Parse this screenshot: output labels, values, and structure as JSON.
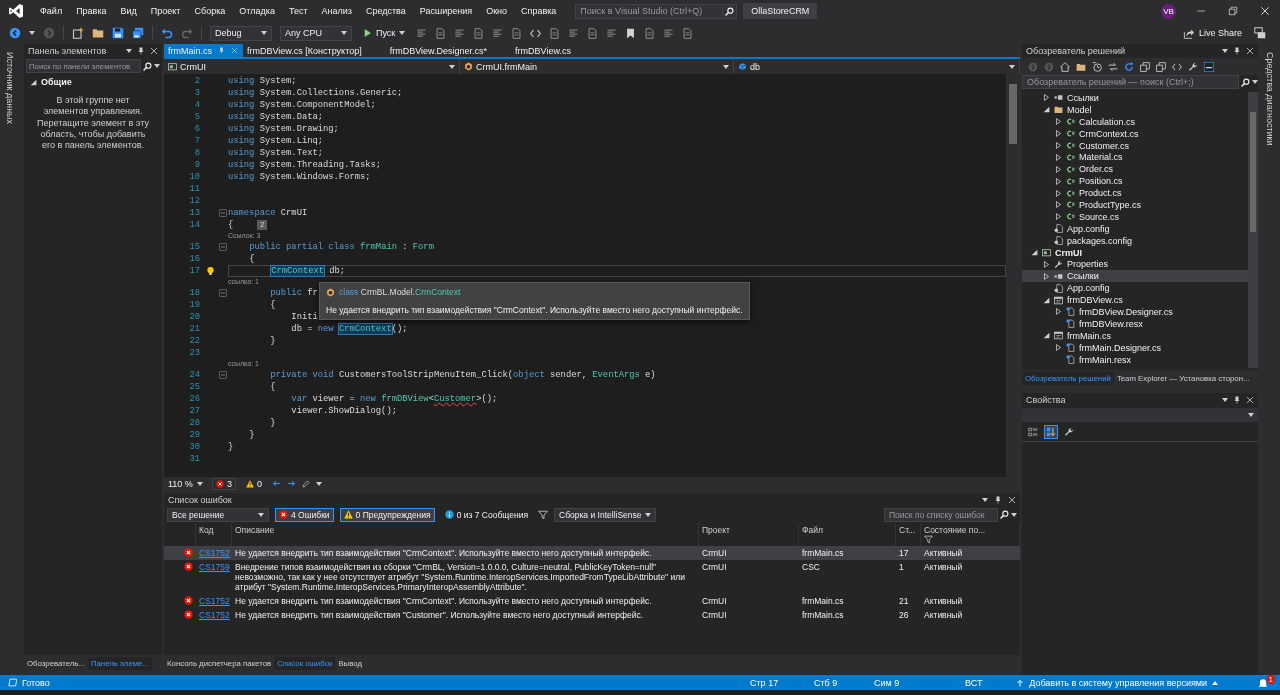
{
  "window": {
    "menu": [
      "Файл",
      "Правка",
      "Вид",
      "Проект",
      "Сборка",
      "Отладка",
      "Тест",
      "Анализ",
      "Средства",
      "Расширения",
      "Окно",
      "Справка"
    ],
    "search": {
      "placeholder": "Поиск в Visual Studio (Ctrl+Q)"
    },
    "solution_name": "OllaStoreCRM",
    "account": "VB"
  },
  "toolbar": {
    "configuration": "Debug",
    "platform": "Any CPU",
    "start": "Пуск",
    "live_share": "Live Share"
  },
  "left_strip": "Источник данных",
  "toolbox": {
    "title": "Панель элементов",
    "search": {
      "placeholder": "Поиск по панели элементов"
    },
    "group": {
      "label": "Общие",
      "expanded": true
    },
    "empty_message": "В этой группе нет элементов управления. Перетащите элемент в эту область, чтобы добавить его в панель элементов."
  },
  "left_tabs": [
    {
      "label": "Обозреватель...",
      "selected": false
    },
    {
      "label": "Панель элеме...",
      "selected": true
    }
  ],
  "document_tabs": [
    {
      "label": "frmMain.cs",
      "selected": true
    },
    {
      "label": "frmDBView.cs [Конструктор]",
      "selected": false
    },
    {
      "label": "frmDBView.Designer.cs*",
      "selected": false
    },
    {
      "label": "frmDBView.cs",
      "selected": false
    }
  ],
  "navigation": [
    {
      "kind": "project",
      "label": "CrmUI"
    },
    {
      "kind": "class",
      "label": "CrmUI.frmMain"
    },
    {
      "kind": "field",
      "label": "db"
    }
  ],
  "editor": {
    "rows": [
      {
        "n": "2",
        "code": [
          {
            "text": "using",
            "kind": "keyword"
          },
          {
            "text": " System;"
          }
        ]
      },
      {
        "n": "3",
        "code": [
          {
            "text": "using",
            "kind": "keyword"
          },
          {
            "text": " System.Collections.Generic;"
          }
        ]
      },
      {
        "n": "4",
        "code": [
          {
            "text": "using",
            "kind": "keyword"
          },
          {
            "text": " System.ComponentModel;"
          }
        ]
      },
      {
        "n": "5",
        "code": [
          {
            "text": "using",
            "kind": "keyword"
          },
          {
            "text": " System.Data;"
          }
        ]
      },
      {
        "n": "6",
        "code": [
          {
            "text": "using",
            "kind": "keyword"
          },
          {
            "text": " System.Drawing;"
          }
        ]
      },
      {
        "n": "7",
        "code": [
          {
            "text": "using",
            "kind": "keyword"
          },
          {
            "text": " System.Linq;"
          }
        ]
      },
      {
        "n": "8",
        "code": [
          {
            "text": "using",
            "kind": "keyword"
          },
          {
            "text": " System.Text;"
          }
        ]
      },
      {
        "n": "9",
        "code": [
          {
            "text": "using",
            "kind": "keyword"
          },
          {
            "text": " System.Threading.Tasks;"
          }
        ]
      },
      {
        "n": "10",
        "code": [
          {
            "text": "using",
            "kind": "keyword"
          },
          {
            "text": " System.Windows.Forms;"
          }
        ]
      },
      {
        "n": "11"
      },
      {
        "n": "12"
      },
      {
        "n": "13",
        "fold": true,
        "code": [
          {
            "text": "namespace",
            "kind": "keyword"
          },
          {
            "text": " CrmUI"
          }
        ]
      },
      {
        "n": "14",
        "code": [
          {
            "text": "{"
          }
        ],
        "hint": "2"
      },
      {
        "lens": "Ссылок: 3"
      },
      {
        "n": "15",
        "fold": true,
        "code": [
          {
            "text": "    public",
            "kind": "keyword"
          },
          {
            "text": " partial",
            "kind": "keyword"
          },
          {
            "text": " class",
            "kind": "keyword"
          },
          {
            "text": " frmMain",
            "kind": "type"
          },
          {
            "text": " : "
          },
          {
            "text": "Form",
            "kind": "type"
          }
        ]
      },
      {
        "n": "16",
        "code": [
          {
            "text": "    {"
          }
        ]
      },
      {
        "n": "17",
        "current": true,
        "lightbulb": true,
        "code": [
          {
            "text": "        CrmContext",
            "kind": "reference"
          },
          {
            "text": " db;"
          }
        ]
      },
      {
        "lens": "ссылка: 1"
      },
      {
        "n": "18",
        "fold": true,
        "code": [
          {
            "text": "        public",
            "kind": "keyword"
          },
          {
            "text": " fr"
          }
        ]
      },
      {
        "n": "19",
        "code": [
          {
            "text": "        {"
          }
        ]
      },
      {
        "n": "20",
        "code": [
          {
            "text": "            Initi"
          }
        ]
      },
      {
        "n": "21",
        "code": [
          {
            "text": "            db = "
          },
          {
            "text": "new",
            "kind": "keyword"
          },
          {
            "text": " CrmContext",
            "kind": "reference"
          },
          {
            "text": "();"
          }
        ]
      },
      {
        "n": "22",
        "code": [
          {
            "text": "        }"
          }
        ]
      },
      {
        "n": "23"
      },
      {
        "lens": "ссылка: 1"
      },
      {
        "n": "24",
        "fold": true,
        "code": [
          {
            "text": "        private",
            "kind": "keyword"
          },
          {
            "text": " void",
            "kind": "keyword"
          },
          {
            "text": " CustomersToolStripMenuItem_Click("
          },
          {
            "text": "object",
            "kind": "keyword"
          },
          {
            "text": " sender, "
          },
          {
            "text": "EventArgs",
            "kind": "type"
          },
          {
            "text": " e)"
          }
        ]
      },
      {
        "n": "25",
        "code": [
          {
            "text": "        {"
          }
        ]
      },
      {
        "n": "26",
        "code": [
          {
            "text": "            var",
            "kind": "keyword"
          },
          {
            "text": " viewer = "
          },
          {
            "text": "new",
            "kind": "keyword"
          },
          {
            "text": " frmDBView",
            "kind": "type"
          },
          {
            "text": "<"
          },
          {
            "text": "Customer",
            "kind": "error_type"
          },
          {
            "text": ">();"
          }
        ]
      },
      {
        "n": "27",
        "code": [
          {
            "text": "            viewer.ShowDialog();"
          }
        ]
      },
      {
        "n": "28",
        "code": [
          {
            "text": "        }"
          }
        ]
      },
      {
        "n": "29",
        "code": [
          {
            "text": "    }"
          }
        ]
      },
      {
        "n": "30",
        "code": [
          {
            "text": "}"
          }
        ]
      },
      {
        "n": "31"
      }
    ],
    "tooltip": {
      "signature": [
        {
          "text": "class",
          "kind": "keyword"
        },
        {
          "text": " CrmBL.Model."
        },
        {
          "text": "CrmContext",
          "kind": "type"
        }
      ],
      "message": "Не удается внедрить тип взаимодействия \"CrmContext\". Используйте вместо него доступный интерфейс."
    }
  },
  "editor_status": {
    "zoom": "110 %",
    "errors": "3",
    "warnings": "0"
  },
  "error_list": {
    "title": "Список ошибок",
    "scope": "Все решение",
    "filters": [
      {
        "kind": "error",
        "label": "4 Ошибки",
        "selected": true
      },
      {
        "kind": "warning",
        "label": "0 Предупреждения",
        "selected": true
      },
      {
        "kind": "info",
        "label": "0 из 7 Сообщения",
        "selected": false
      }
    ],
    "source": "Сборка и IntelliSense",
    "search": {
      "placeholder": "Поиск по списку ошибок"
    },
    "columns": [
      "Код",
      "Описание",
      "Проект",
      "Файл",
      "Ст...",
      "Состояние по..."
    ],
    "rows": [
      {
        "code": "CS1752",
        "description": "Не удается внедрить тип взаимодействия \"CrmContext\". Используйте вместо него доступный интерфейс.",
        "project": "CrmUI",
        "file": "frmMain.cs",
        "line": "17",
        "state": "Активный",
        "selected": true
      },
      {
        "code": "CS1759",
        "description": "Внедрение типов взаимодействия из сборки \"CrmBL, Version=1.0.0.0, Culture=neutral, PublicKeyToken=null\" невозможно, так как у нее отсутствует атрибут \"System.Runtime.InteropServices.ImportedFromTypeLibAttribute\" или атрибут \"System.Runtime.InteropServices.PrimaryInteropAssemblyAttribute\".",
        "project": "CrmUI",
        "file": "CSC",
        "line": "1",
        "state": "Активный",
        "selected": false
      },
      {
        "code": "CS1752",
        "description": "Не удается внедрить тип взаимодействия \"CrmContext\". Используйте вместо него доступный интерфейс.",
        "project": "CrmUI",
        "file": "frmMain.cs",
        "line": "21",
        "state": "Активный",
        "selected": false
      },
      {
        "code": "CS1752",
        "description": "Не удается внедрить тип взаимодействия \"Customer\". Используйте вместо него доступный интерфейс.",
        "project": "CrmUI",
        "file": "frmMain.cs",
        "line": "26",
        "state": "Активный",
        "selected": false
      }
    ]
  },
  "bottom_tabs": [
    {
      "label": "Консоль диспетчера пакетов",
      "selected": false
    },
    {
      "label": "Список ошибок",
      "selected": true
    },
    {
      "label": "Вывод",
      "selected": false
    }
  ],
  "solution_explorer": {
    "title": "Обозреватель решений",
    "search": {
      "placeholder": "Обозреватель решений — поиск (Ctrl+;)"
    },
    "tree": [
      {
        "children": [
          {
            "label": "Ссылки",
            "kind": "references",
            "expanded": false,
            "selected": false
          },
          {
            "label": "Model",
            "kind": "folder",
            "expanded": true,
            "selected": false,
            "children": [
              {
                "label": "Calculation.cs",
                "kind": "csharp",
                "expanded": false,
                "selected": false
              },
              {
                "label": "CrmContext.cs",
                "kind": "csharp",
                "expanded": false,
                "selected": false
              },
              {
                "label": "Customer.cs",
                "kind": "csharp",
                "expanded": false,
                "selected": false
              },
              {
                "label": "Material.cs",
                "kind": "csharp",
                "expanded": false,
                "selected": false
              },
              {
                "label": "Order.cs",
                "kind": "csharp",
                "expanded": false,
                "selected": false
              },
              {
                "label": "Position.cs",
                "kind": "csharp",
                "expanded": false,
                "selected": false
              },
              {
                "label": "Product.cs",
                "kind": "csharp",
                "expanded": false,
                "selected": false
              },
              {
                "label": "ProductType.cs",
                "kind": "csharp",
                "expanded": false,
                "selected": false
              },
              {
                "label": "Source.cs",
                "kind": "csharp",
                "expanded": false,
                "selected": false
              }
            ]
          },
          {
            "label": "App.config",
            "kind": "config",
            "selected": false
          },
          {
            "label": "packages.config",
            "kind": "config",
            "selected": false
          }
        ]
      },
      {
        "label": "CrmUI",
        "kind": "project",
        "expanded": true,
        "selected": false,
        "children": [
          {
            "label": "Properties",
            "kind": "properties",
            "expanded": false,
            "selected": false
          },
          {
            "label": "Ссылки",
            "kind": "references",
            "expanded": false,
            "selected": true
          },
          {
            "label": "App.config",
            "kind": "config",
            "selected": false
          },
          {
            "label": "frmDBView.cs",
            "kind": "form",
            "expanded": true,
            "selected": false,
            "children": [
              {
                "label": "frmDBView.Designer.cs",
                "kind": "designer",
                "expanded": false,
                "selected": false
              },
              {
                "label": "frmDBView.resx",
                "kind": "resource",
                "selected": false
              }
            ]
          },
          {
            "label": "frmMain.cs",
            "kind": "form",
            "expanded": true,
            "selected": false,
            "children": [
              {
                "label": "frmMain.Designer.cs",
                "kind": "designer",
                "expanded": false,
                "selected": false
              },
              {
                "label": "frmMain.resx",
                "kind": "resource",
                "selected": false
              }
            ]
          }
        ]
      }
    ]
  },
  "solution_tabs": [
    {
      "label": "Обозреватель решений",
      "selected": true
    },
    {
      "label": "Team Explorer — Установка сторон...",
      "selected": false
    }
  ],
  "properties": {
    "title": "Свойства",
    "buttons": [
      {
        "kind": "categorized",
        "selected": false
      },
      {
        "kind": "alphabetical",
        "selected": true
      },
      {
        "kind": "pages",
        "selected": false
      }
    ]
  },
  "right_strip": "Средства диагностики",
  "status_bar": {
    "message": "Готово",
    "line": "Стр 17",
    "column": "Стб 9",
    "char": "Сим 9",
    "mode": "ВСТ",
    "source_control": "Добавить в систему управления версиями",
    "notifications": "1"
  }
}
